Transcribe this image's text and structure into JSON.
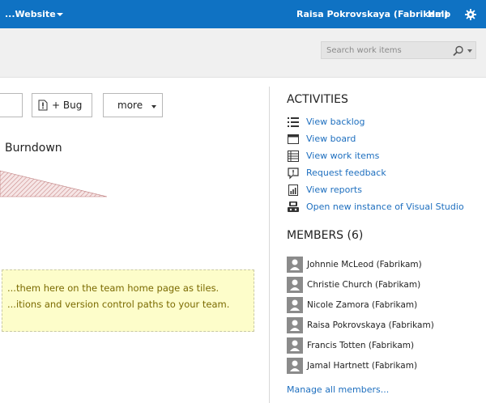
{
  "topbar": {
    "project": "...Website",
    "user": "Raisa Pokrovskaya (Fabrikam)",
    "help": "Help",
    "settings_icon": "gear-icon"
  },
  "search": {
    "placeholder": "Search work items",
    "icon": "search-icon"
  },
  "toolbar": {
    "bug_label": "+ Bug",
    "more_label": "more"
  },
  "burndown": {
    "title": "Burndown"
  },
  "tile_note": {
    "line1": "...them here on the team home page as tiles.",
    "line2": "...itions and version control paths to your team."
  },
  "activities": {
    "heading": "ACTIVITIES",
    "items": [
      {
        "label": "View backlog",
        "icon": "backlog-icon"
      },
      {
        "label": "View board",
        "icon": "board-icon"
      },
      {
        "label": "View work items",
        "icon": "work-items-icon"
      },
      {
        "label": "Request feedback",
        "icon": "feedback-icon"
      },
      {
        "label": "View reports",
        "icon": "reports-icon"
      },
      {
        "label": "Open new instance of Visual Studio",
        "icon": "visual-studio-icon"
      }
    ]
  },
  "members": {
    "heading": "MEMBERS (6)",
    "items": [
      {
        "name": "Johnnie McLeod (Fabrikam)"
      },
      {
        "name": "Christie Church (Fabrikam)"
      },
      {
        "name": "Nicole Zamora (Fabrikam)"
      },
      {
        "name": "Raisa Pokrovskaya (Fabrikam)"
      },
      {
        "name": "Francis Totten (Fabrikam)"
      },
      {
        "name": "Jamal Hartnett (Fabrikam)"
      }
    ],
    "manage_link": "Manage all members..."
  },
  "colors": {
    "topbar": "#0f72c3",
    "link": "#1e6fbf",
    "note_bg": "#fdfdca",
    "note_text": "#7a6a00"
  }
}
